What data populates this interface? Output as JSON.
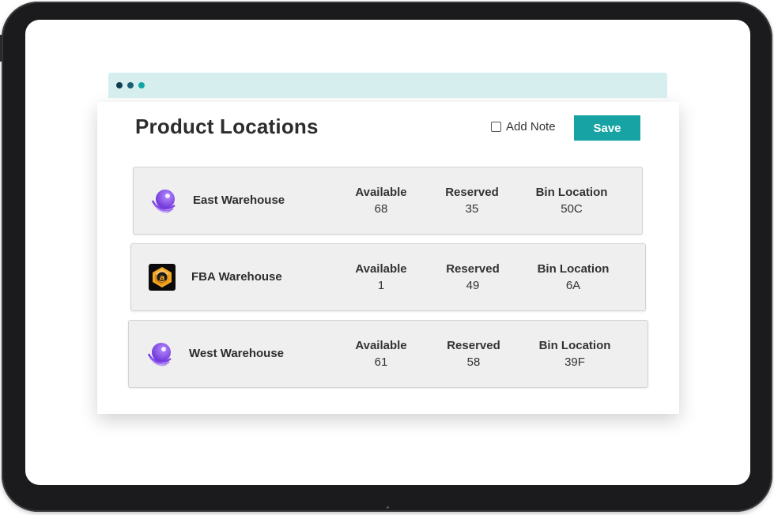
{
  "header": {
    "title": "Product Locations",
    "add_note_label": "Add Note",
    "save_label": "Save"
  },
  "locations": [
    {
      "name": "East Warehouse",
      "icon": "purple-sphere-logo-icon",
      "available_label": "Available",
      "available": "68",
      "reserved_label": "Reserved",
      "reserved": "35",
      "bin_label": "Bin Location",
      "bin": "50C"
    },
    {
      "name": "FBA Warehouse",
      "icon": "amazon-box-logo-icon",
      "available_label": "Available",
      "available": "1",
      "reserved_label": "Reserved",
      "reserved": "49",
      "bin_label": "Bin Location",
      "bin": "6A"
    },
    {
      "name": "West Warehouse",
      "icon": "purple-sphere-logo-icon",
      "available_label": "Available",
      "available": "61",
      "reserved_label": "Reserved",
      "reserved": "58",
      "bin_label": "Bin Location",
      "bin": "39F"
    }
  ],
  "colors": {
    "accent": "#17a3a3",
    "titlebar": "#d6eeee",
    "row_bg": "#efefef",
    "logo_purple": "#7b3fe4",
    "amazon_orange": "#f5a623"
  }
}
